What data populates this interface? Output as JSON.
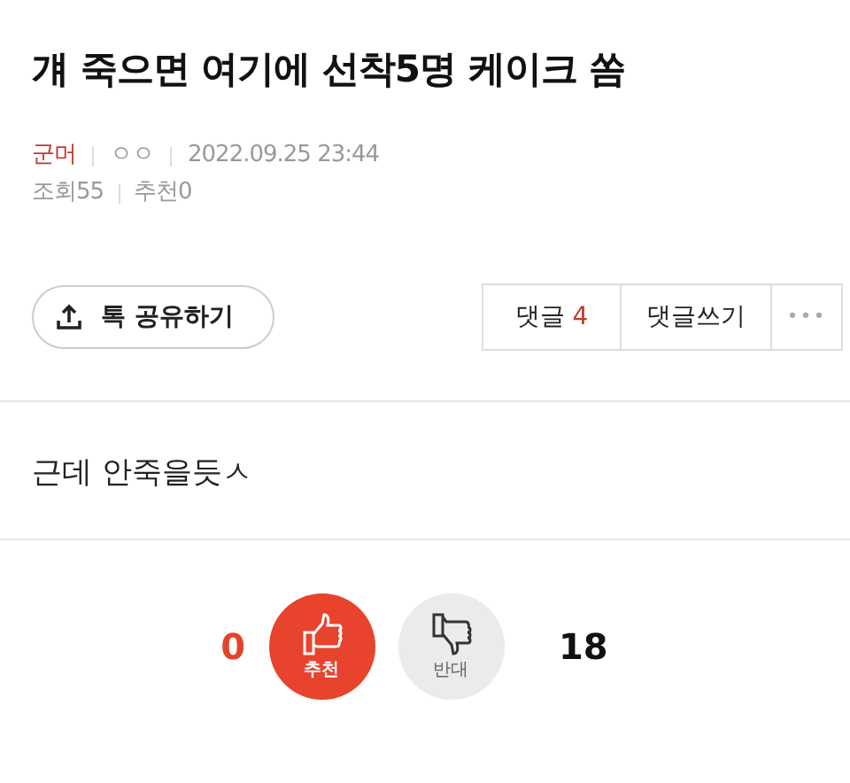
{
  "title": "걔 죽으면 여기에 선착5명 케이크 쏨",
  "meta": {
    "board": "군머",
    "author": "ㅇㅇ",
    "datetime": "2022.09.25 23:44",
    "views": "조회55",
    "recommends": "추천0"
  },
  "share_button": "톡 공유하기",
  "comment_buttons": {
    "comments_label": "댓글",
    "comments_count": "4",
    "write": "댓글쓰기",
    "more": "•••"
  },
  "body": "근데 안죽을듯ㅅ",
  "votes": {
    "up_count": "0",
    "up_label": "추천",
    "down_label": "반대",
    "down_count": "18"
  }
}
